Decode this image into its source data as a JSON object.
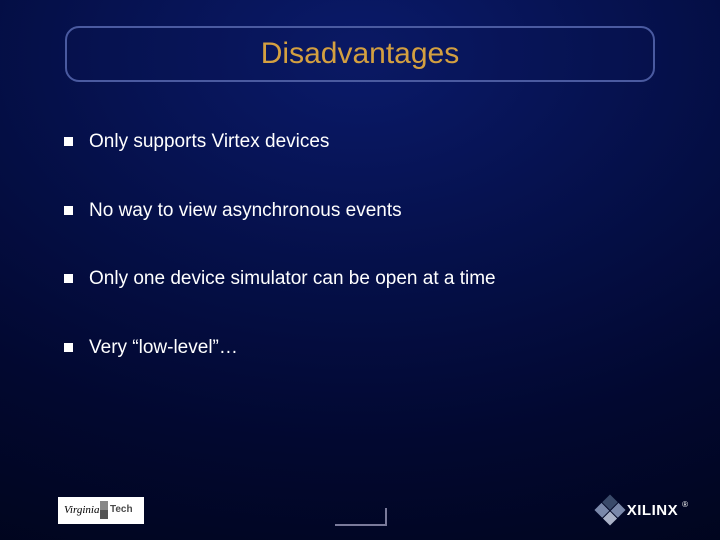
{
  "title": "Disadvantages",
  "bullets": [
    "Only supports Virtex devices",
    "No way to view asynchronous events",
    "Only one device simulator can be open at a time",
    "Very “low-level”…"
  ],
  "footer": {
    "left_logo": {
      "line1": "Virginia",
      "line2": "Tech"
    },
    "right_logo": {
      "brand": "XILINX",
      "registered": "®"
    }
  }
}
